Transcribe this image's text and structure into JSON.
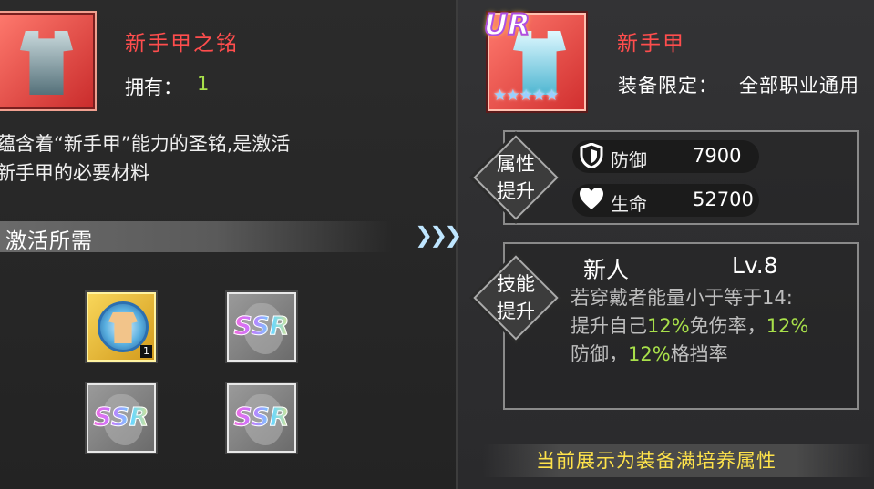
{
  "material": {
    "name": "新手甲之铭",
    "own_label": "拥有：",
    "own_count": "1",
    "description_line1": "蕴含着“新手甲”能力的圣铭,是激活",
    "description_line2": "新手甲的必要材料",
    "requirement_label": "激活所需",
    "slots": [
      {
        "type": "medal",
        "count": "1"
      },
      {
        "type": "ssr",
        "text": "SSR"
      },
      {
        "type": "ssr",
        "text": "SSR"
      },
      {
        "type": "ssr",
        "text": "SSR"
      }
    ]
  },
  "arrows": "❯❯❯",
  "equipment": {
    "rarity": "UR",
    "stars": "★★★★★",
    "name": "新手甲",
    "restrict_label": "装备限定：",
    "restrict_value": "全部职业通用",
    "attr_section_label": [
      "属性",
      "提升"
    ],
    "stats": [
      {
        "icon": "shield-icon",
        "name": "防御",
        "value": "7900"
      },
      {
        "icon": "heart-icon",
        "name": "生命",
        "value": "52700"
      }
    ],
    "skill_section_label": [
      "技能",
      "提升"
    ],
    "skill": {
      "name": "新人",
      "level": "Lv.8",
      "line1": "若穿戴者能量小于等于14:",
      "line2_pre": "提升自己",
      "line2_hl1": "12%",
      "line2_mid": "免伤率，",
      "line2_hl2": "12%",
      "line3_pre": "防御，",
      "line3_hl": "12%",
      "line3_post": "格挡率"
    },
    "footer": "当前展示为装备满培养属性"
  },
  "colors": {
    "title_red": "#ff4d4d",
    "highlight_green": "#a8e04a",
    "footer_yellow": "#ffe34a"
  }
}
